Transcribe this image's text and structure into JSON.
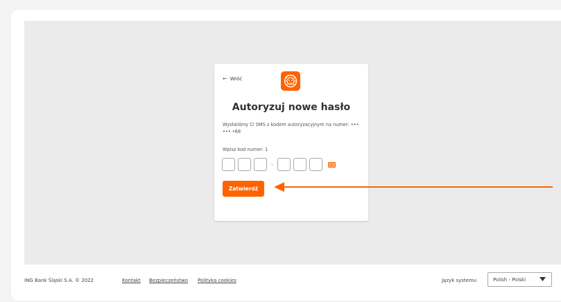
{
  "card": {
    "back_label": "Wróć",
    "title": "Autoryzuj nowe hasło",
    "message": "Wysłaliśmy Ci SMS z kodem autoryzacyjnym na numer: ••• ••• •68",
    "code_label": "Wpisz kod numer: 1",
    "code_separator": "-",
    "submit_label": "Zatwierdź"
  },
  "footer": {
    "copyright": "ING Bank Śląski S.A. © 2022",
    "links": [
      "Kontakt",
      "Bezpieczeństwo",
      "Polityka cookies"
    ],
    "language_label": "Język systemu",
    "language_value": "Polish - Polski"
  },
  "colors": {
    "brand": "#ff6200",
    "annotation": "#ff6200"
  },
  "icons": {
    "back": "arrow-left-icon",
    "logo": "ing-lion-icon",
    "sms": "sms-icon",
    "select": "caret-down-icon"
  }
}
